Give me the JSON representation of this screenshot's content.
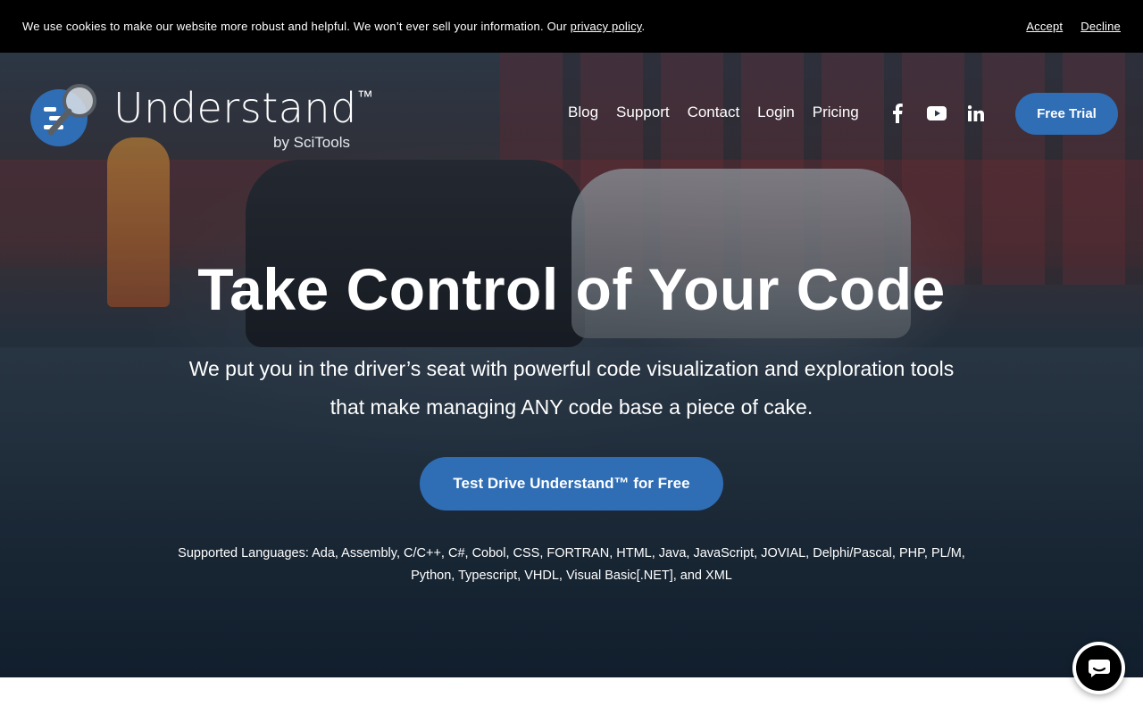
{
  "cookie_bar": {
    "message": "We use cookies to make our website more robust and helpful. We won’t ever sell your information. Our ",
    "policy_link": "privacy policy",
    "period": ".",
    "accept_label": "Accept",
    "decline_label": "Decline"
  },
  "logo": {
    "wordmark": "Understand",
    "trademark": "™",
    "byline": "by SciTools",
    "icon": "magnifier-code-logo-icon"
  },
  "nav": {
    "items": [
      "Blog",
      "Support",
      "Contact",
      "Login",
      "Pricing"
    ]
  },
  "social": {
    "icons": [
      "facebook-icon",
      "youtube-icon",
      "linkedin-icon"
    ]
  },
  "header_cta": {
    "label": "Free Trial"
  },
  "hero": {
    "headline": "Take Control of Your Code",
    "subhead": "We put you in the driver’s seat with powerful code visualization and exploration tools that make managing ANY code base a piece of cake.",
    "cta_label": "Test Drive Understand™ for Free",
    "languages": "Supported Languages: Ada, Assembly, C/C++, C#, Cobol, CSS, FORTRAN, HTML, Java, JavaScript, JOVIAL, Delphi/Pascal, PHP, PL/M, Python, Typescript, VHDL, Visual Basic[.NET], and XML"
  },
  "chat": {
    "icon": "chat-bubble-icon"
  },
  "colors": {
    "accent": "#2f6db5",
    "cookie_bar": "#000000",
    "text_on_dark": "#ffffff"
  }
}
